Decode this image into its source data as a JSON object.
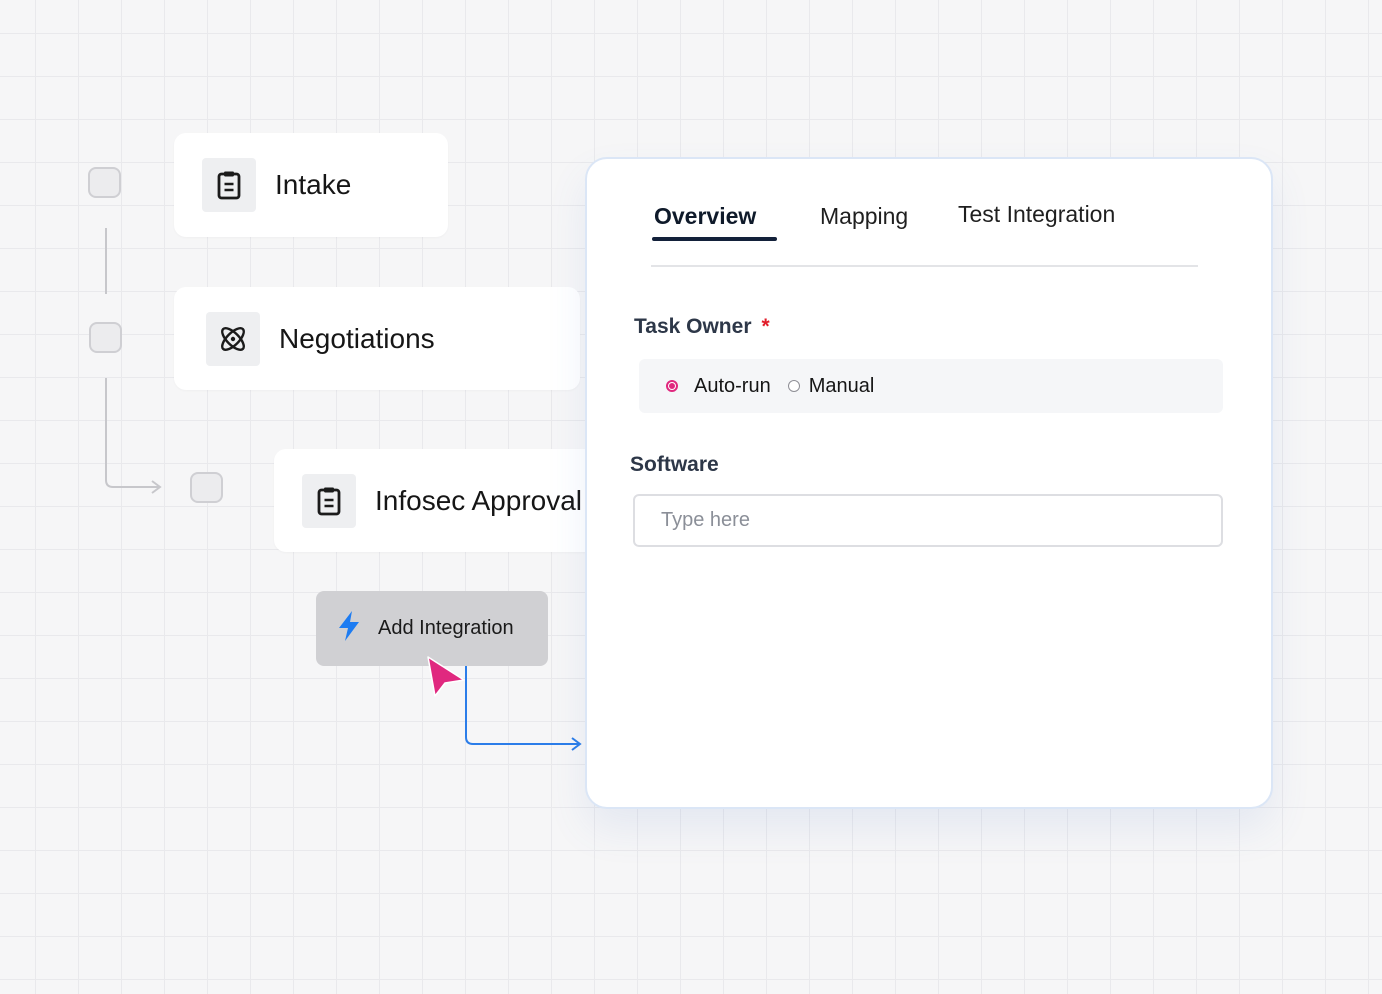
{
  "workflow": {
    "nodes": [
      {
        "label": "Intake",
        "icon": "clipboard-icon"
      },
      {
        "label": "Negotiations",
        "icon": "atom-icon"
      },
      {
        "label": "Infosec Approval",
        "icon": "clipboard-icon"
      }
    ],
    "add_integration_label": "Add Integration"
  },
  "panel": {
    "tabs": [
      {
        "label": "Overview",
        "active": true
      },
      {
        "label": "Mapping",
        "active": false
      },
      {
        "label": "Test Integration",
        "active": false
      }
    ],
    "task_owner": {
      "label": "Task Owner",
      "required_mark": "*",
      "options": [
        {
          "label": "Auto-run",
          "selected": true
        },
        {
          "label": "Manual",
          "selected": false
        }
      ]
    },
    "software": {
      "label": "Software",
      "placeholder": "Type here",
      "value": ""
    }
  },
  "colors": {
    "accent": "#e0287f",
    "tab_active": "#13213a",
    "connector_blue": "#2b7de9",
    "required": "#e11d2a"
  }
}
